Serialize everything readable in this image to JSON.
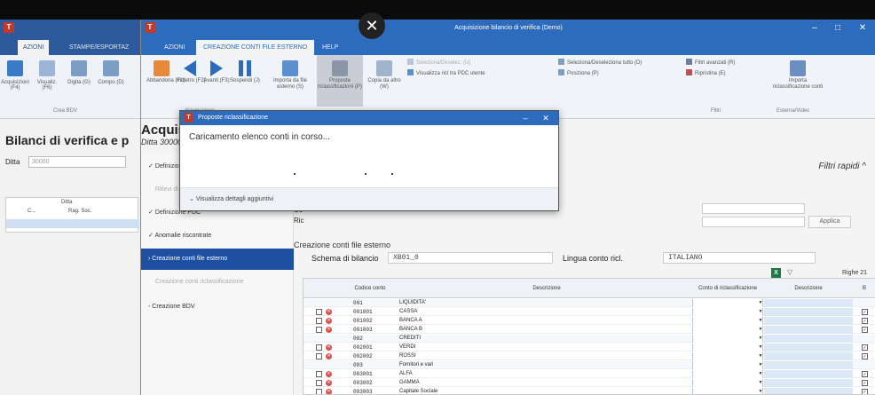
{
  "back_window": {
    "logo": "T",
    "tabs": [
      "AZIONI",
      "STAMPE/ESPORTAZ"
    ],
    "ribbon_labels": [
      "Acquisizioni (F4)",
      "Visualiz. (F6)",
      "Digita (G)",
      "Compo (D)"
    ],
    "group_label": "Crea BDV",
    "heading": "Bilanci di verifica e p",
    "ditta_label": "Ditta",
    "ditta_value": "30000",
    "grid_header_ditta": "Ditta",
    "grid_col1": "C...",
    "grid_col2": "Rag. Soc."
  },
  "main_window": {
    "logo": "T",
    "title": "Acquisizione bilancio di verifica (Demo)",
    "tabs": [
      "AZIONI",
      "CREAZIONE CONTI FILE ESTERNO",
      "HELP"
    ],
    "ribbon": {
      "nav_buttons": [
        "Abbandona (F1)",
        "Indietro (F2)",
        "Avanti (F3)",
        "Sospendi (J)"
      ],
      "nav_group": "Navigazione",
      "import_label": "Importa da file esterno (S)",
      "proposte_label": "Proposte riclassificazioni (P)",
      "copia_label": "Copia da altro (W)",
      "small_items": [
        "Seleziona/Deselez. (U)",
        "Visualizza ricl tra PDC utente",
        "Seleziona/Deseleziona tutto (D)",
        "Posiziona (P)",
        "Filtri avanzati (R)",
        "Ripristina (E)"
      ],
      "filtri_group": "Filtri",
      "import_right_label": "Importa riclassificazione conti",
      "right_group": "Esterna/Videc"
    },
    "heading": "Acquisizione bilancio di verific",
    "subheading": "Ditta 30000 - EST SRL   Esercizio 2022.0",
    "filtri_rapidi": "Filtri rapidi",
    "nav_items": [
      "Definizione dati generali",
      "Rilievi di acquisizione",
      "Definizione PDC",
      "Anomalie riscontrate",
      "Creazione conti file esterno",
      "Creazione conti riclassificazione",
      "Creazione BDV"
    ],
    "cont_label": "Co",
    "ric_label": "Ric",
    "applica": "Applica",
    "section_title": "Creazione conti file esterno",
    "schema_label": "Schema di bilancio",
    "schema_value": "XB01_0",
    "lingua_label": "Lingua conto ricl.",
    "lingua_value": "ITALIANO",
    "excel_icon_glyph": "X",
    "righe": "Righe 21",
    "columns": {
      "codice": "Codice conto",
      "descrizione": "Descrizione",
      "conto_ricl": "Conto di riclassificazione",
      "descrizione2": "Descrizione",
      "flag": "B"
    },
    "rows": [
      {
        "code": "001",
        "desc": "LIQUIDITA'",
        "group": true
      },
      {
        "code": "001001",
        "desc": "CASSA",
        "group": false
      },
      {
        "code": "001002",
        "desc": "BANCA A",
        "group": false
      },
      {
        "code": "001003",
        "desc": "BANCA B",
        "group": false
      },
      {
        "code": "002",
        "desc": "CREDITI",
        "group": true
      },
      {
        "code": "002001",
        "desc": "VERDI",
        "group": false
      },
      {
        "code": "002002",
        "desc": "ROSSI",
        "group": false
      },
      {
        "code": "003",
        "desc": "Fornitori e vari",
        "group": true
      },
      {
        "code": "003001",
        "desc": "ALFA",
        "group": false
      },
      {
        "code": "003002",
        "desc": "GAMMA",
        "group": false
      },
      {
        "code": "003003",
        "desc": "Capitale Sociale",
        "group": false
      }
    ]
  },
  "dialog": {
    "logo": "T",
    "title": "Proposte riclassificazione",
    "message": "Caricamento elenco conti in corso...",
    "details": "Visualizza dettagli aggiuntivi"
  }
}
